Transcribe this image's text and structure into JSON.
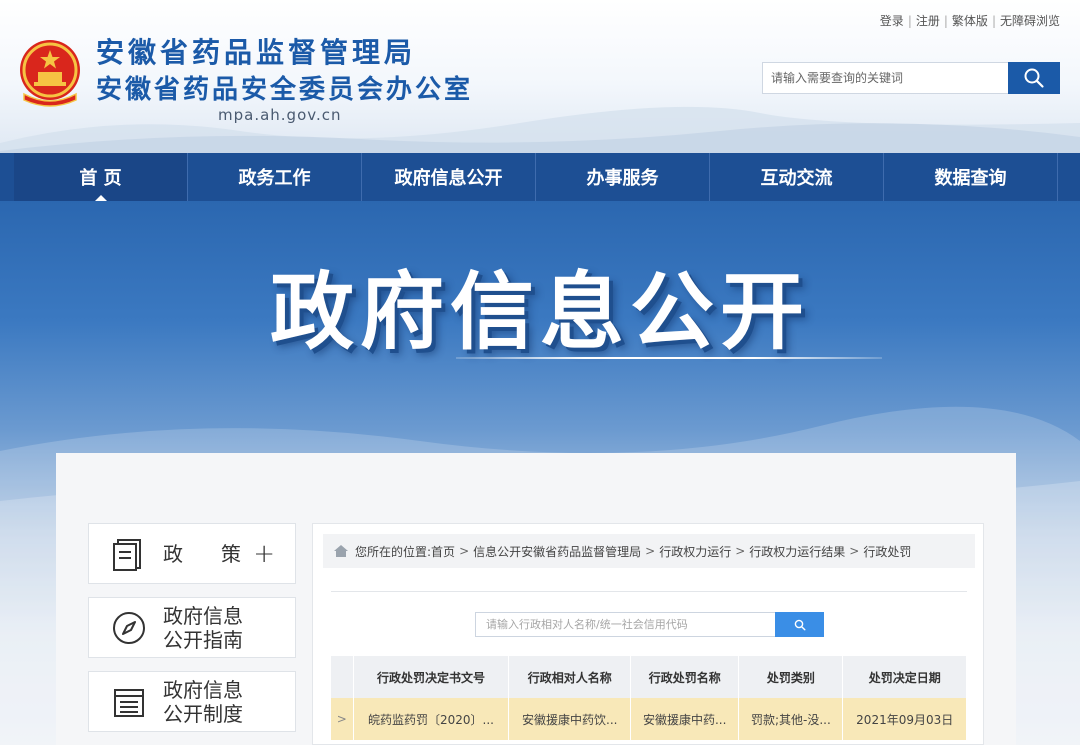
{
  "header": {
    "title": "安徽省药品监督管理局",
    "subtitle": "安徽省药品安全委员会办公室",
    "domain": "mpa.ah.gov.cn",
    "top_links": [
      "登录",
      "注册",
      "繁体版",
      "无障碍浏览"
    ],
    "search_placeholder": "请输入需要查询的关键词"
  },
  "nav": {
    "items": [
      {
        "label": "首 页",
        "active": true
      },
      {
        "label": "政务工作"
      },
      {
        "label": "政府信息公开"
      },
      {
        "label": "办事服务"
      },
      {
        "label": "互动交流"
      },
      {
        "label": "数据查询"
      }
    ]
  },
  "banner": {
    "title": "政府信息公开"
  },
  "sidebar": {
    "items": [
      {
        "label_1": "政",
        "label_2": "策",
        "plus": "+",
        "icon": "book-icon"
      },
      {
        "label_1": "政府信息",
        "label_2": "公开指南",
        "icon": "compass-icon"
      },
      {
        "label_1": "政府信息",
        "label_2": "公开制度",
        "icon": "document-list-icon"
      }
    ]
  },
  "breadcrumb": {
    "prefix": "您所在的位置:",
    "items": [
      "首页",
      "信息公开安徽省药品监督管理局",
      "行政权力运行",
      "行政权力运行结果",
      "行政处罚"
    ]
  },
  "content_search": {
    "placeholder": "请输入行政相对人名称/统一社会信用代码"
  },
  "table": {
    "headers": [
      "行政处罚决定书文号",
      "行政相对人名称",
      "行政处罚名称",
      "处罚类别",
      "处罚决定日期"
    ],
    "rows": [
      {
        "expand": ">",
        "doc_no": "皖药监药罚〔2020〕...",
        "party": "安徽援康中药饮...",
        "name": "安徽援康中药...",
        "category": "罚款;其他-没...",
        "date": "2021年09月03日"
      }
    ]
  },
  "colors": {
    "brand_blue": "#1b5aa8",
    "nav_bg": "#1d4f94",
    "row_highlight": "#f8e8b8",
    "search_btn": "#3a8ee6"
  }
}
